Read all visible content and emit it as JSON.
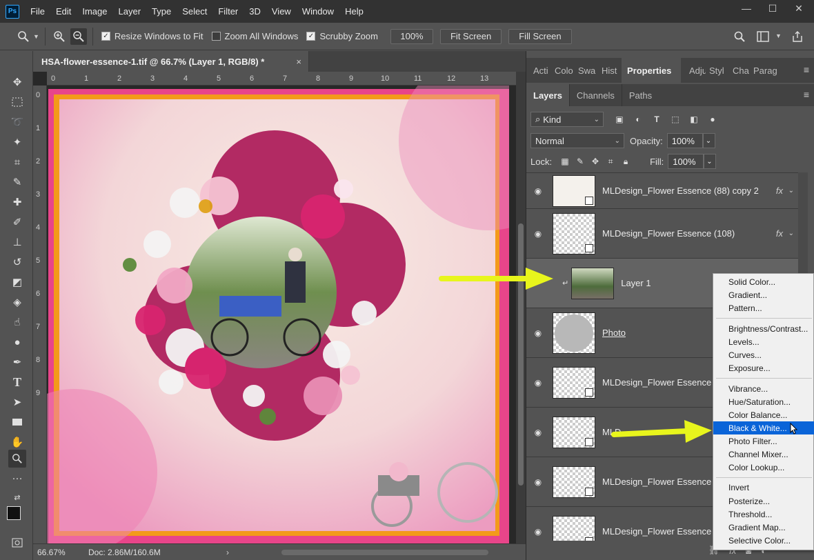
{
  "app": {
    "logo": "Ps"
  },
  "menu": [
    "File",
    "Edit",
    "Image",
    "Layer",
    "Type",
    "Select",
    "Filter",
    "3D",
    "View",
    "Window",
    "Help"
  ],
  "window_controls": {
    "minimize": "—",
    "maximize": "☐",
    "close": "✕"
  },
  "options": {
    "resize_windows": "Resize Windows to Fit",
    "zoom_all": "Zoom All Windows",
    "scrubby_zoom": "Scrubby Zoom",
    "zoom_value": "100%",
    "fit_screen": "Fit Screen",
    "fill_screen": "Fill Screen"
  },
  "document": {
    "tab_title": "HSA-flower-essence-1.tif @ 66.7% (Layer 1, RGB/8) *",
    "close": "×",
    "ruler_top": [
      "0",
      "1",
      "2",
      "3",
      "4",
      "5",
      "6",
      "7",
      "8",
      "9",
      "10",
      "11",
      "12",
      "13"
    ],
    "ruler_left": [
      "0",
      "1",
      "2",
      "3",
      "4",
      "5",
      "6",
      "7",
      "8",
      "9"
    ]
  },
  "status": {
    "zoom": "66.67%",
    "doc": "Doc: 2.86M/160.6M",
    "arrow": "›"
  },
  "panels": {
    "top_tabs": [
      "Acti",
      "Colo",
      "Swa",
      "Hist",
      "Properties",
      "Adju",
      "Styl",
      "Cha",
      "Parag"
    ],
    "layer_tabs": [
      "Layers",
      "Channels",
      "Paths"
    ],
    "kind_label": "Kind",
    "blend_mode": "Normal",
    "opacity_label": "Opacity:",
    "opacity_value": "100%",
    "lock_label": "Lock:",
    "fill_label": "Fill:",
    "fill_value": "100%"
  },
  "layers": [
    {
      "name": "MLDesign_Flower Essence (88) copy 2",
      "fx": "fx"
    },
    {
      "name": "MLDesign_Flower Essence (108)",
      "fx": "fx"
    },
    {
      "name": "Layer 1",
      "fx": ""
    },
    {
      "name": "Photo",
      "fx": ""
    },
    {
      "name": "MLDesign_Flower Essence (",
      "fx": ""
    },
    {
      "name": "MLD",
      "fx": ""
    },
    {
      "name": "MLDesign_Flower Essence (",
      "fx": ""
    },
    {
      "name": "MLDesign_Flower Essence (",
      "fx": ""
    }
  ],
  "layers_bottom_fx": "fx",
  "adjustment_menu": {
    "group1": [
      "Solid Color...",
      "Gradient...",
      "Pattern..."
    ],
    "group2": [
      "Brightness/Contrast...",
      "Levels...",
      "Curves...",
      "Exposure..."
    ],
    "group3": [
      "Vibrance...",
      "Hue/Saturation...",
      "Color Balance...",
      "Black & White...",
      "Photo Filter...",
      "Channel Mixer...",
      "Color Lookup..."
    ],
    "group4": [
      "Invert",
      "Posterize...",
      "Threshold...",
      "Gradient Map...",
      "Selective Color..."
    ],
    "highlighted": "Black & White..."
  },
  "colors": {
    "arrow": "#e8f51c",
    "highlight": "#0a64d8",
    "page_frame": "#e8458a"
  }
}
